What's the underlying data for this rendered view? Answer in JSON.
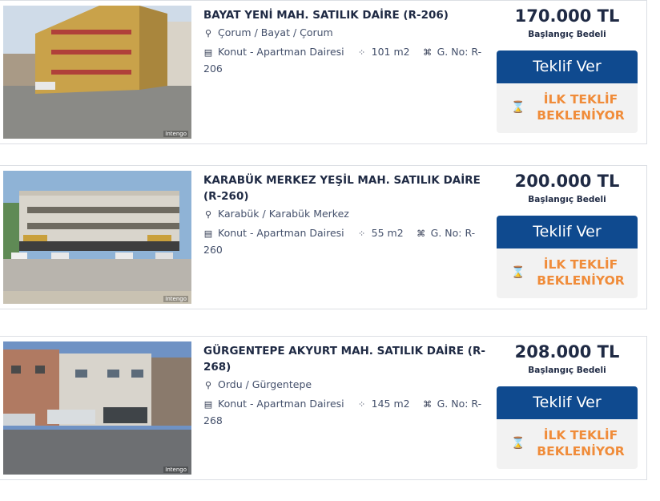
{
  "listings": [
    {
      "title": "BAYAT YENİ MAH. SATILIK DAİRE (R-206)",
      "location": "Çorum / Bayat / Çorum",
      "type": "Konut - Apartman Dairesi",
      "area": "101 m2",
      "gno": "G. No: R-206",
      "price": "170.000 TL",
      "price_label": "Başlangıç Bedeli",
      "bid_button": "Teklif Ver",
      "status": "İLK TEKLİF BEKLENİYOR",
      "watermark": "Intengo"
    },
    {
      "title": "KARABÜK MERKEZ YEŞİL MAH. SATILIK DAİRE (R-260)",
      "location": "Karabük / Karabük Merkez",
      "type": "Konut - Apartman Dairesi",
      "area": "55 m2",
      "gno": "G. No: R-260",
      "price": "200.000 TL",
      "price_label": "Başlangıç Bedeli",
      "bid_button": "Teklif Ver",
      "status": "İLK TEKLİF BEKLENİYOR",
      "watermark": "Intengo"
    },
    {
      "title": "GÜRGENTEPE AKYURT MAH. SATILIK DAİRE (R-268)",
      "location": "Ordu / Gürgentepe",
      "type": "Konut - Apartman Dairesi",
      "area": "145 m2",
      "gno": "G. No: R-268",
      "price": "208.000 TL",
      "price_label": "Başlangıç Bedeli",
      "bid_button": "Teklif Ver",
      "status": "İLK TEKLİF BEKLENİYOR",
      "watermark": "Intengo"
    }
  ],
  "icons": {
    "location": "location-pin-icon",
    "type": "building-icon",
    "area": "area-dots-icon",
    "gno": "parcel-icon",
    "status": "hourglass-icon"
  },
  "colors": {
    "primary_button": "#0f4a8f",
    "status_text": "#f08c3a",
    "title_text": "#1f2a44"
  }
}
